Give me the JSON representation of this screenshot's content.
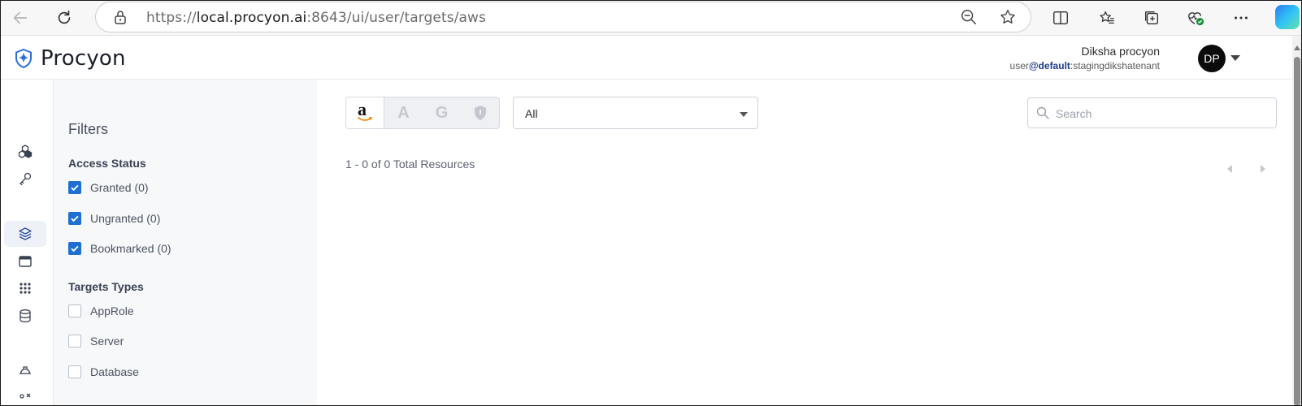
{
  "browser": {
    "url_scheme": "https://",
    "url_host": "local.procyon.ai",
    "url_rest": ":8643/ui/user/targets/aws"
  },
  "app": {
    "brand": "Procyon",
    "accent_color": "#1f6fd1",
    "user": {
      "name": "Diksha procyon",
      "prefix": "user",
      "at_default": "@default",
      "tenant": ":stagingdikshatenant",
      "initials": "DP"
    }
  },
  "sidebar": {
    "items": [
      {
        "icon": "cubes-icon"
      },
      {
        "icon": "key-icon"
      },
      {
        "icon": "layers-icon",
        "active": true
      },
      {
        "icon": "window-icon"
      },
      {
        "icon": "grid-icon"
      },
      {
        "icon": "database-icon"
      },
      {
        "icon": "helmet-icon"
      },
      {
        "icon": "tools-icon"
      }
    ]
  },
  "filters": {
    "title": "Filters",
    "access_status": {
      "title": "Access Status",
      "items": [
        {
          "label": "Granted (0)",
          "checked": true
        },
        {
          "label": "Ungranted (0)",
          "checked": true
        },
        {
          "label": "Bookmarked (0)",
          "checked": true
        }
      ]
    },
    "target_types": {
      "title": "Targets Types",
      "items": [
        {
          "label": "AppRole",
          "checked": false
        },
        {
          "label": "Server",
          "checked": false
        },
        {
          "label": "Database",
          "checked": false
        }
      ]
    }
  },
  "main": {
    "cloud_tabs": [
      {
        "label": "a",
        "icon": "amazon-icon",
        "active": true
      },
      {
        "label": "A",
        "icon": "azure-icon",
        "active": false
      },
      {
        "label": "G",
        "icon": "google-icon",
        "active": false
      },
      {
        "label": "",
        "icon": "shield-icon",
        "active": false
      }
    ],
    "filter_select": {
      "value": "All"
    },
    "search": {
      "placeholder": "Search"
    },
    "total_text": "1 - 0 of 0 Total Resources"
  }
}
